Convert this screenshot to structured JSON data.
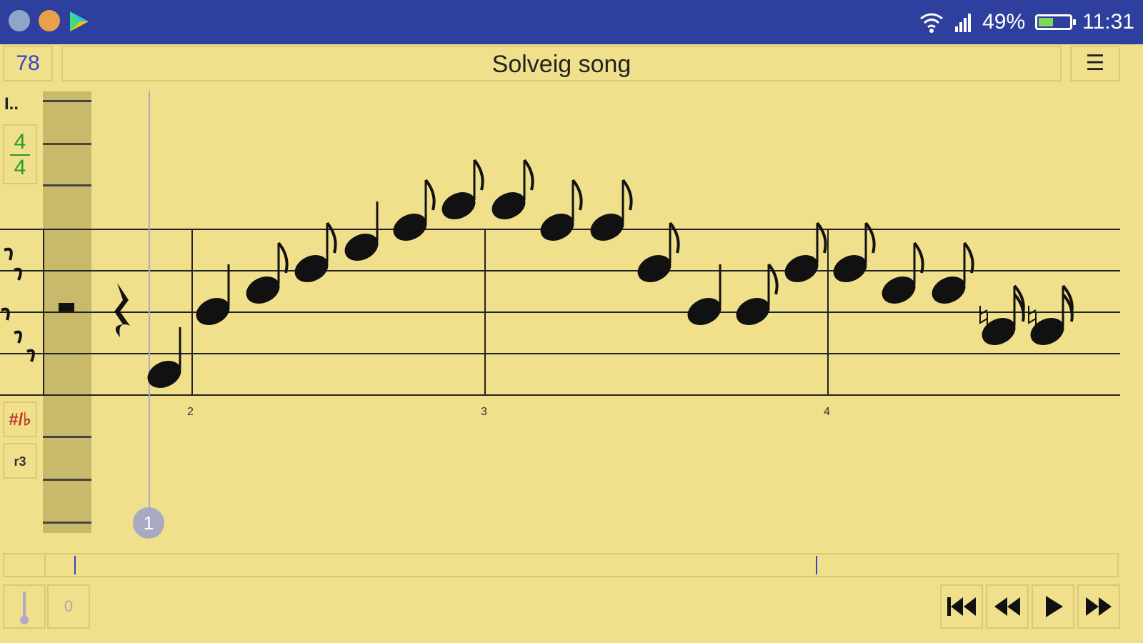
{
  "status_bar": {
    "battery": "49%",
    "battery_level": 0.49,
    "time": "11:31"
  },
  "header": {
    "tempo": "78",
    "title": "Solveig song",
    "menu_icon": "☰"
  },
  "side": {
    "time_sig_top": "4",
    "time_sig_bottom": "4",
    "accidentals_label": "#/♭",
    "triplet_label": "r3"
  },
  "measure_numbers": [
    "2",
    "3",
    "4"
  ],
  "cursor_badge": "1",
  "bottom": {
    "counter_value": "0"
  },
  "colors": {
    "background": "#f0e08c",
    "status_bar": "#2e3f9e",
    "accent_blue": "#3344cc"
  }
}
